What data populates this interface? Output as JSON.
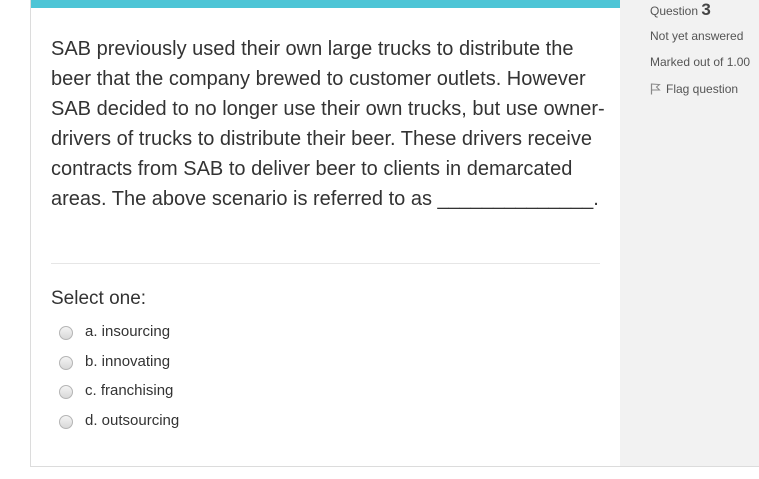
{
  "question": {
    "text": "SAB previously used their own large trucks to distribute the beer that the company brewed to customer outlets. However SAB decided to no longer use their own trucks, but use owner-drivers of trucks to distribute their beer. These drivers receive contracts from SAB to deliver beer to clients in demarcated areas. The above scenario is referred to as ______________.",
    "select_prompt": "Select one:",
    "options": [
      {
        "label": "a. insourcing"
      },
      {
        "label": "b. innovating"
      },
      {
        "label": "c. franchising"
      },
      {
        "label": "d. outsourcing"
      }
    ]
  },
  "info": {
    "question_label": "Question",
    "question_number": "3",
    "status": "Not yet answered",
    "marks": "Marked out of 1.00",
    "flag_label": "Flag question",
    "flag_icon": "flag-outline-icon"
  },
  "colors": {
    "accent_bar": "#4dc5d6",
    "info_background": "#f2f2f2"
  }
}
